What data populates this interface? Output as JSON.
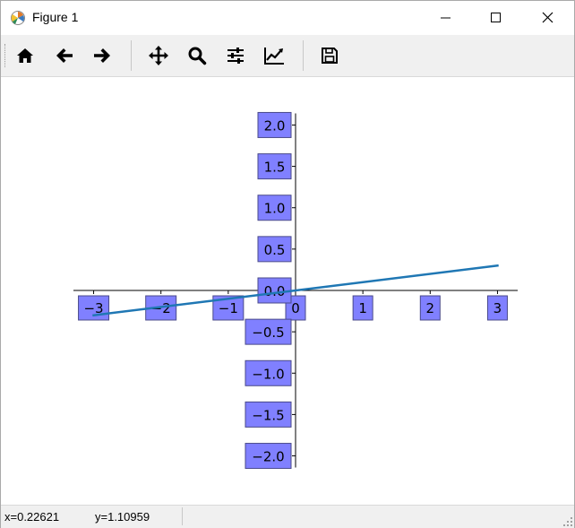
{
  "window": {
    "title": "Figure 1",
    "app_icon": "matplotlib-icon",
    "controls": [
      "minimize-icon",
      "maximize-icon",
      "close-icon"
    ]
  },
  "toolbar": {
    "buttons": [
      {
        "name": "home",
        "icon": "home-icon"
      },
      {
        "name": "back",
        "icon": "arrow-left-icon"
      },
      {
        "name": "forward",
        "icon": "arrow-right-icon"
      },
      {
        "name": "pan",
        "icon": "move-icon"
      },
      {
        "name": "zoom",
        "icon": "magnifier-icon"
      },
      {
        "name": "subplots",
        "icon": "sliders-icon"
      },
      {
        "name": "edit-axes",
        "icon": "line-chart-icon"
      },
      {
        "name": "save",
        "icon": "floppy-disk-icon"
      }
    ]
  },
  "status": {
    "x": "x=0.22621",
    "y": "y=1.10959"
  },
  "chart_data": {
    "type": "line",
    "title": "",
    "xlabel": "",
    "ylabel": "",
    "xlim": [
      -3.3,
      3.3
    ],
    "ylim": [
      -2.2,
      2.2
    ],
    "spines": "centered at origin",
    "tick_label_box_color": "#8080ff",
    "line_color": "#1f77b4",
    "x_ticks": [
      -3,
      -2,
      -1,
      0,
      1,
      2,
      3
    ],
    "x_tick_labels": [
      "−3",
      "−2",
      "−1",
      "0",
      "1",
      "2",
      "3"
    ],
    "y_ticks": [
      -2.0,
      -1.5,
      -1.0,
      -0.5,
      0.0,
      0.5,
      1.0,
      1.5,
      2.0
    ],
    "y_tick_labels": [
      "−2.0",
      "−1.5",
      "−1.0",
      "−0.5",
      "0.0",
      "0.5",
      "1.0",
      "1.5",
      "2.0"
    ],
    "series": [
      {
        "x": [
          -3,
          3
        ],
        "y": [
          -0.3,
          0.3
        ]
      }
    ]
  }
}
